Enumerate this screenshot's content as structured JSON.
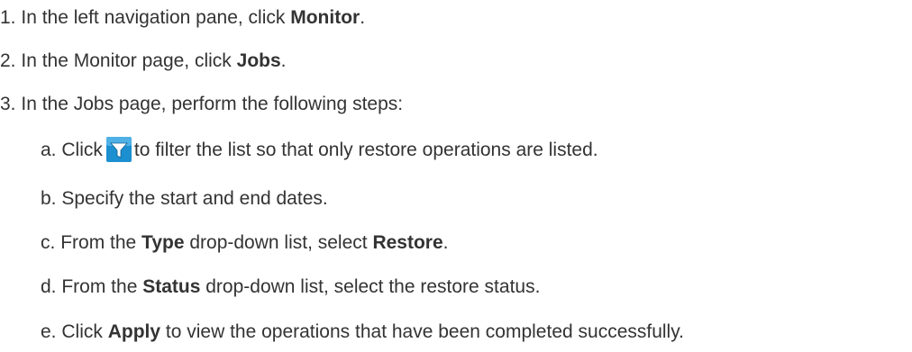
{
  "steps": [
    {
      "number": "1.",
      "text_before": "In the left navigation pane, click ",
      "bold": "Monitor",
      "text_after": "."
    },
    {
      "number": "2.",
      "text_before": "In the Monitor page, click ",
      "bold": "Jobs",
      "text_after": "."
    },
    {
      "number": "3.",
      "text": "In the Jobs page, perform the following steps:"
    }
  ],
  "substeps": [
    {
      "letter": "a.",
      "text_before": "Click",
      "icon": "filter-icon",
      "text_after": "to filter the list so that only restore operations are listed."
    },
    {
      "letter": "b.",
      "text": "Specify the start and end dates."
    },
    {
      "letter": "c.",
      "text_before": "From the ",
      "bold1": "Type",
      "text_mid": " drop-down list, select ",
      "bold2": "Restore",
      "text_after": "."
    },
    {
      "letter": "d.",
      "text_before": "From the ",
      "bold1": "Status",
      "text_after": " drop-down list, select the restore status."
    },
    {
      "letter": "e.",
      "text_before": "Click ",
      "bold1": "Apply",
      "text_after": " to view the operations that have been completed successfully."
    }
  ],
  "colors": {
    "text": "#333333",
    "icon_background": "#1c8fd0",
    "icon_funnel": "#ffffff"
  }
}
